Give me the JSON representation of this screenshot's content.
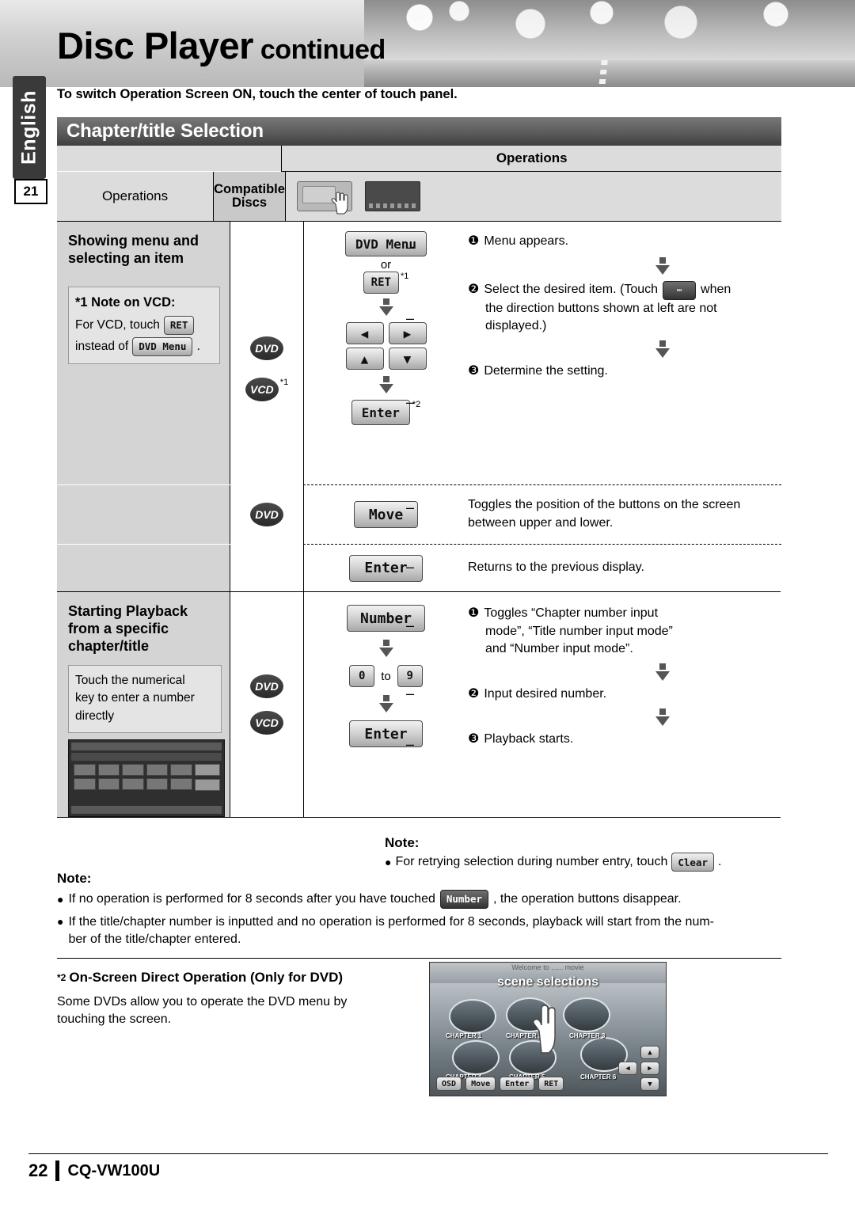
{
  "header": {
    "title_main": "Disc Player",
    "title_continued": " continued",
    "side_tab": "English",
    "page_ref": "21"
  },
  "intro": "To switch Operation Screen ON, touch the center of touch panel.",
  "section": {
    "title": "Chapter/title Selection"
  },
  "table": {
    "header": {
      "operations_left": "Operations",
      "compatible_line1": "Compatible",
      "compatible_line2": "Discs",
      "operations_right": "Operations",
      "icon_touch": "touch-panel-icon",
      "icon_screen": "screen-icon"
    },
    "rows": [
      {
        "title_line1": "Showing menu and",
        "title_line2": "selecting an item",
        "note_title": "*1 Note on VCD:",
        "note_text_1": "For VCD, touch",
        "note_chip_1": "RET",
        "note_text_2": "instead of",
        "note_chip_2": "DVD Menu",
        "note_text_3": ".",
        "discs": [
          "DVD",
          "VCD"
        ],
        "disc_sup": "*1",
        "buttons": {
          "dvd_menu": "DVD Menu",
          "or": "or",
          "ret": "RET",
          "ret_sup": "*1",
          "enter": "Enter",
          "enter_sup": "*2"
        },
        "steps": [
          {
            "num": "❶",
            "text": "Menu appears.",
            "dash": "–"
          },
          {
            "num": "❷",
            "text_a": "Select the desired item. (Touch",
            "text_b": "when",
            "text_c": "the direction buttons shown at left are not",
            "text_d": "displayed.)",
            "dash": "–"
          },
          {
            "num": "❸",
            "text": "Determine the setting.",
            "dash": "–"
          }
        ]
      },
      {
        "disc": "DVD",
        "button": "Move",
        "dash": "–",
        "text_line1": "Toggles the position of the buttons on the screen",
        "text_line2": "between upper and lower."
      },
      {
        "button": "Enter",
        "dash": "–",
        "text_line1": "Returns to the previous display."
      },
      {
        "title_line1": "Starting Playback",
        "title_line2": "from a specific",
        "title_line3": "chapter/title",
        "note_line1": "Touch the numerical",
        "note_line2": "key to enter a number",
        "note_line3": "directly",
        "discs": [
          "DVD",
          "VCD"
        ],
        "buttons": {
          "number": "Number",
          "key_from": "0",
          "key_to_word": "to",
          "key_to": "9",
          "enter": "Enter"
        },
        "steps": [
          {
            "num": "❶",
            "line1": "Toggles “Chapter number input",
            "line2": "mode”, “Title number input mode”",
            "line3": "and “Number input mode”.",
            "dash": "–"
          },
          {
            "num": "❷",
            "line1": "Input desired number.",
            "dash": "–"
          },
          {
            "num": "❸",
            "line1": "Playback starts.",
            "dash": "–"
          }
        ],
        "inner_note": {
          "label": "Note:",
          "bullet": "●",
          "text": "For retrying selection during number entry, touch",
          "chip": "Clear",
          "tail": "."
        }
      }
    ]
  },
  "notes": {
    "label": "Note:",
    "items": [
      {
        "bullet": "●",
        "text_a": "If no operation is performed for 8 seconds after you have touched",
        "chip": "Number",
        "text_b": ", the operation buttons disappear."
      },
      {
        "bullet": "●",
        "text_a": "If the title/chapter number is inputted and no operation is performed for 8 seconds, playback will start from the num-",
        "text_b": "ber of the title/chapter entered."
      }
    ]
  },
  "footnote": {
    "marker": "*2",
    "title": "On-Screen Direct Operation (Only for DVD)",
    "line1": "Some DVDs allow you to operate the DVD menu by",
    "line2": "touching the screen.",
    "photo": {
      "top_text": "Welcome to ...... movie",
      "title": "scene selections",
      "labels": [
        "CHAPTER 1",
        "CHAPTER 2",
        "CHAPTER 3",
        "CHAPTER 4",
        "CHAPTER 5",
        "CHAPTER 6"
      ],
      "controls": [
        "OSD",
        "Move",
        "Enter",
        "RET"
      ]
    }
  },
  "footer": {
    "page_number": "22",
    "model": "CQ-VW100U"
  }
}
